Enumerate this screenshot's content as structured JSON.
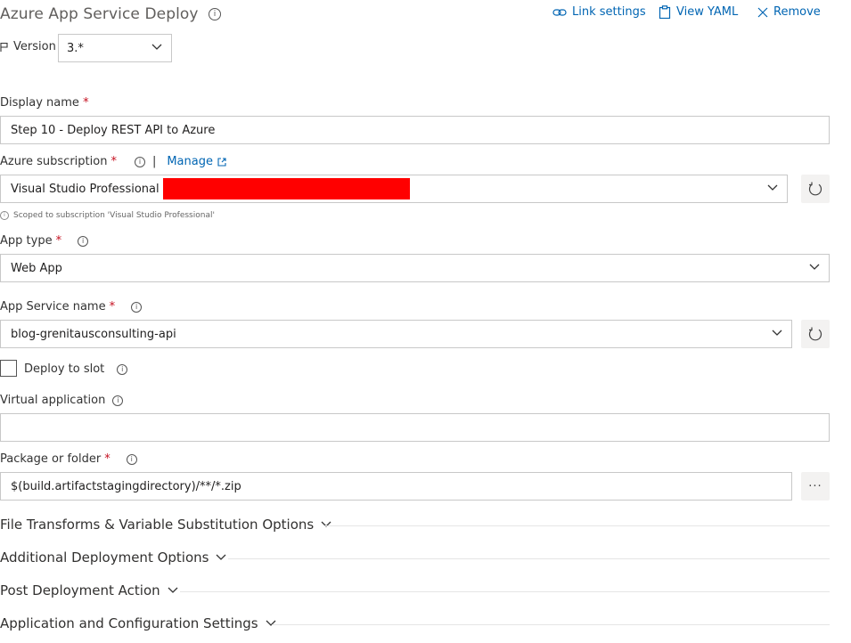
{
  "header": {
    "title": "Azure App Service Deploy",
    "link_settings": "Link settings",
    "view_yaml": "View YAML",
    "remove": "Remove"
  },
  "version": {
    "label": "Version",
    "value": "3.*"
  },
  "display_name": {
    "label": "Display name",
    "required": "*",
    "value": "Step 10 - Deploy REST API to Azure"
  },
  "azure_subscription": {
    "label": "Azure subscription",
    "required": "*",
    "separator": "|",
    "manage": "Manage",
    "value": "Visual Studio Professional",
    "scope_note": "Scoped to subscription 'Visual Studio Professional'",
    "redaction_color": "#ff0000"
  },
  "app_type": {
    "label": "App type",
    "required": "*",
    "value": "Web App"
  },
  "app_service_name": {
    "label": "App Service name",
    "required": "*",
    "value": "blog-grenitausconsulting-api"
  },
  "deploy_to_slot": {
    "label": "Deploy to slot",
    "checked": false
  },
  "virtual_application": {
    "label": "Virtual application",
    "value": ""
  },
  "package_or_folder": {
    "label": "Package or folder",
    "required": "*",
    "value": "$(build.artifactstagingdirectory)/**/*.zip",
    "browse": "···"
  },
  "sections": [
    "File Transforms & Variable Substitution Options",
    "Additional Deployment Options",
    "Post Deployment Action",
    "Application and Configuration Settings"
  ],
  "colors": {
    "accent": "#0065b3",
    "required": "#c50f1f",
    "border": "#c8c8c8"
  }
}
